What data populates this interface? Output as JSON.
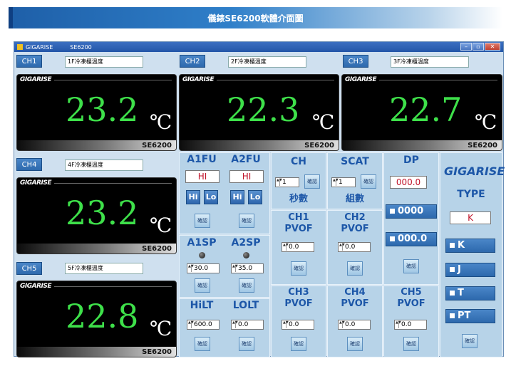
{
  "banner": {
    "title": "儀錶SE6200軟體介面圖"
  },
  "window": {
    "app_name": "GIGARISE",
    "model_tab": "SE6200",
    "min": "–",
    "max": "▫",
    "close": "✕"
  },
  "channels": [
    {
      "tag": "CH1",
      "name": "1F冷凍櫃溫度",
      "value": "23.2",
      "unit": "℃",
      "model": "SE6200",
      "brand": "GIGARISE"
    },
    {
      "tag": "CH2",
      "name": "2F冷凍櫃溫度",
      "value": "22.3",
      "unit": "℃",
      "model": "SE6200",
      "brand": "GIGARISE"
    },
    {
      "tag": "CH3",
      "name": "3F冷凍櫃溫度",
      "value": "22.7",
      "unit": "℃",
      "model": "SE6200",
      "brand": "GIGARISE"
    },
    {
      "tag": "CH4",
      "name": "4F冷凍櫃溫度",
      "value": "23.2",
      "unit": "℃",
      "model": "SE6200",
      "brand": "GIGARISE"
    },
    {
      "tag": "CH5",
      "name": "5F冷凍櫃溫度",
      "value": "22.8",
      "unit": "℃",
      "model": "SE6200",
      "brand": "GIGARISE"
    }
  ],
  "controls": {
    "confirm": "確認",
    "a1fu": {
      "label": "A1FU",
      "value": "HI"
    },
    "a2fu": {
      "label": "A2FU",
      "value": "HI"
    },
    "hi": "Hi",
    "lo": "Lo",
    "a1sp": {
      "label": "A1SP",
      "value": "30.0"
    },
    "a2sp": {
      "label": "A2SP",
      "value": "35.0"
    },
    "hilt": {
      "label": "HiLT",
      "value": "600.0"
    },
    "lolt": {
      "label": "LOLT",
      "value": "0.0"
    },
    "ch": {
      "label": "CH",
      "value": "1",
      "sub": "秒數"
    },
    "scat": {
      "label": "SCAT",
      "value": "1",
      "sub": "組數"
    },
    "ch1pvof": {
      "label1": "CH1",
      "label2": "PVOF",
      "value": "0.0"
    },
    "ch2pvof": {
      "label1": "CH2",
      "label2": "PVOF",
      "value": "0.0"
    },
    "ch3pvof": {
      "label1": "CH3",
      "label2": "PVOF",
      "value": "0.0"
    },
    "ch4pvof": {
      "label1": "CH4",
      "label2": "PVOF",
      "value": "0.0"
    },
    "ch5pvof": {
      "label1": "CH5",
      "label2": "PVOF",
      "value": "0.0"
    },
    "dp": {
      "label": "DP",
      "value": "000.0",
      "opt1": "0000",
      "opt2": "000.0"
    },
    "type": {
      "label": "TYPE",
      "value": "K",
      "options": [
        "K",
        "J",
        "T",
        "PT"
      ]
    },
    "logo": "GIGARISE"
  }
}
